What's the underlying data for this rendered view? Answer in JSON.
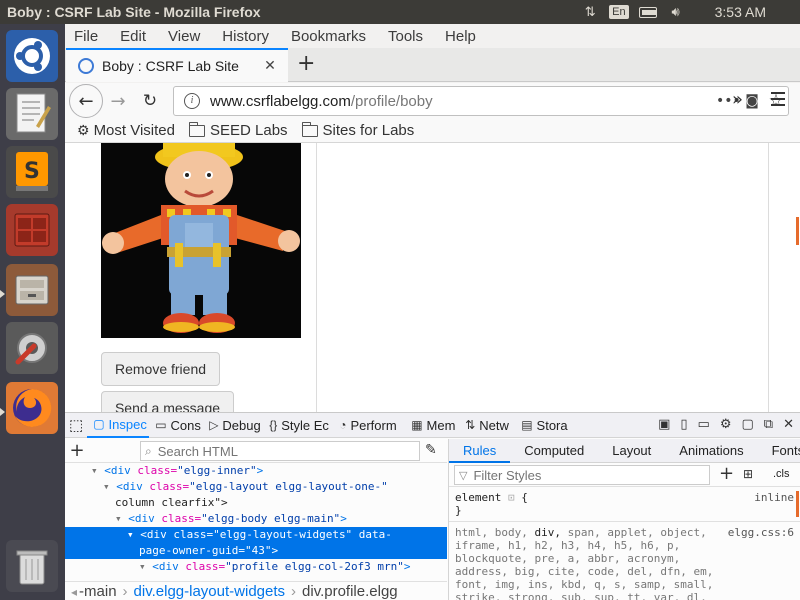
{
  "window": {
    "title": "Boby : CSRF Lab Site - Mozilla Firefox"
  },
  "system_tray": {
    "keyboard_layout": "En",
    "clock": "3:53 AM"
  },
  "launcher": {
    "apps": [
      "ubuntu-dash",
      "text-editor",
      "sublime-text",
      "terminal-emulator",
      "file-manager",
      "system-settings",
      "firefox",
      "trash"
    ]
  },
  "menubar": {
    "items": [
      "File",
      "Edit",
      "View",
      "History",
      "Bookmarks",
      "Tools",
      "Help"
    ]
  },
  "tab": {
    "title": "Boby : CSRF Lab Site"
  },
  "urlbar": {
    "host": "www.csrflabelgg.com",
    "path": "/profile/boby"
  },
  "bookmarks": {
    "items": [
      "Most Visited",
      "SEED Labs",
      "Sites for Labs"
    ]
  },
  "page": {
    "buttons": [
      "Remove friend",
      "Send a message"
    ]
  },
  "devtools": {
    "tabs": [
      "Inspector",
      "Console",
      "Debugger",
      "Style Editor",
      "Performance",
      "Memory",
      "Network",
      "Storage"
    ],
    "tab_labels_visible": [
      "Inspec",
      "Cons",
      "Debug",
      "Style Ec",
      "Perform",
      "Mem",
      "Netw",
      "Stora"
    ],
    "active_tab": "Inspector",
    "search_placeholder": "Search HTML",
    "markup_lines": [
      {
        "indent": 3,
        "text_tag": "div",
        "attrs": [
          {
            "name": "class",
            "value": "elgg-inner"
          }
        ],
        "close": ">",
        "state": "partial"
      },
      {
        "indent": 4,
        "text_tag": "div",
        "attrs": [
          {
            "name": "class",
            "value": "elgg-layout elgg-layout-one-"
          }
        ],
        "close": "",
        "state": "open"
      },
      {
        "indent": 4,
        "continuation": "column clearfix\">",
        "state": "cont"
      },
      {
        "indent": 5,
        "text_tag": "div",
        "attrs": [
          {
            "name": "class",
            "value": "elgg-body elgg-main"
          }
        ],
        "close": ">",
        "state": "open"
      },
      {
        "indent": 6,
        "text_tag": "div",
        "attrs": [
          {
            "name": "class",
            "value": "elgg-layout-widgets"
          },
          {
            "name": "data-",
            "value": ""
          }
        ],
        "close": "",
        "state": "selected"
      },
      {
        "indent": 6,
        "continuation": "page-owner-guid=\"43\">",
        "state": "selected-cont"
      },
      {
        "indent": 7,
        "text_tag": "div",
        "attrs": [
          {
            "name": "class",
            "value": "profile elgg-col-2of3 mrn"
          }
        ],
        "close": ">",
        "state": "open"
      }
    ],
    "breadcrumbs": [
      "-main",
      "div.elgg-layout-widgets",
      "div.profile.elgg"
    ],
    "rules_tabs": [
      "Rules",
      "Computed",
      "Layout",
      "Animations",
      "Fonts"
    ],
    "active_rules_tab": "Rules",
    "filter_placeholder": "Filter Styles",
    "cls_label": ".cls",
    "element_rule": {
      "selector": "element",
      "open": "{",
      "close": "}",
      "source": "inline"
    },
    "stylesheet_rule": {
      "source": "elgg.css:6",
      "selectors": "html, body, div, span, applet, object, iframe, h1, h2, h3, h4, h5, h6, p, blockquote, pre, a, abbr, acronym, address, big, cite, code, del, dfn, em, font, img, ins, kbd, q, s, samp, small, strike, strong, sub, sup, tt, var, dl, dt, dd, ol, ul,",
      "matched": "div"
    }
  },
  "colors": {
    "accent": "#0a84ff",
    "ubuntu_panel": "#3c3b37",
    "launcher_bg": "#3e3e48",
    "selection": "#0074e8"
  }
}
